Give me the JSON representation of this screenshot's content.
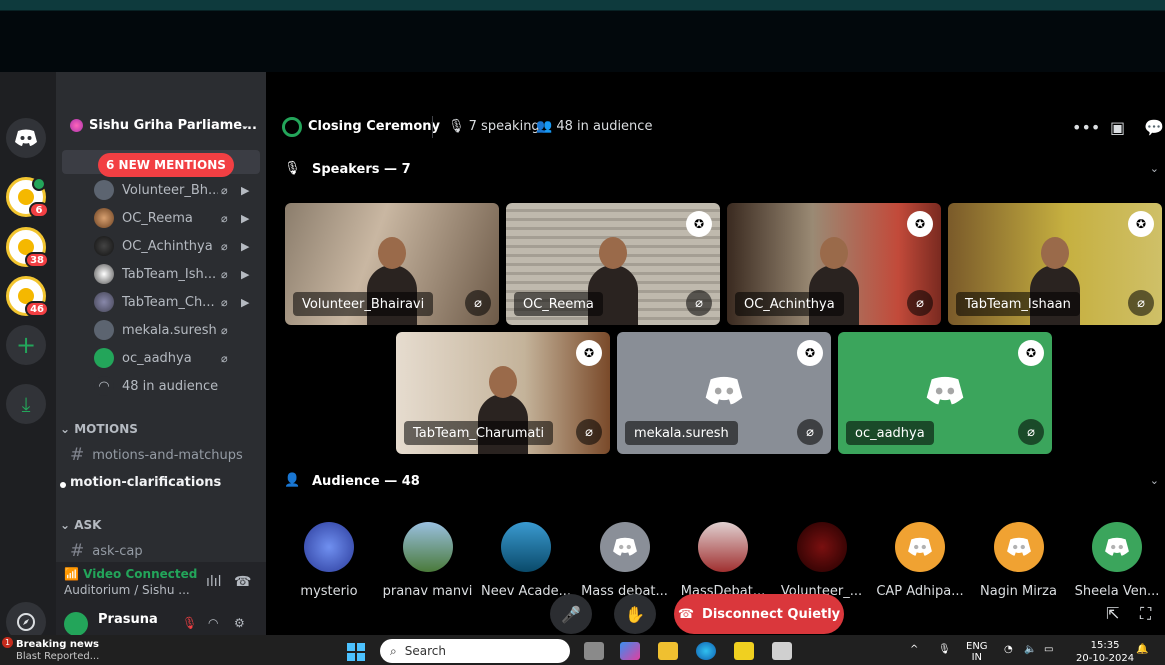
{
  "server": {
    "name": "Sishu Griha Parliame...",
    "mentions": "6 NEW MENTIONS",
    "badges": [
      "6",
      "38",
      "46"
    ]
  },
  "voice_users": [
    {
      "name": "Volunteer_Bh...",
      "avatar": "discord"
    },
    {
      "name": "OC_Reema",
      "avatar": "photo1"
    },
    {
      "name": "OC_Achinthya",
      "avatar": "photo2"
    },
    {
      "name": "TabTeam_Ish...",
      "avatar": "photo3"
    },
    {
      "name": "TabTeam_Ch...",
      "avatar": "photo4"
    },
    {
      "name": "mekala.suresh",
      "avatar": "discord"
    },
    {
      "name": "oc_aadhya",
      "avatar": "green"
    }
  ],
  "audience_row": "48 in audience",
  "categories": {
    "motions": "MOTIONS",
    "ask": "ASK"
  },
  "channels": {
    "motions_and_matchups": "motions-and-matchups",
    "motion_clarifications": "motion-clarifications",
    "ask_cap": "ask-cap"
  },
  "voice_panel": {
    "status": "Video Connected",
    "location": "Auditorium / Sishu ..."
  },
  "user": {
    "name": "Prasuna"
  },
  "stage": {
    "title": "Closing Ceremony",
    "speaking": "7 speaking",
    "audience": "48 in audience",
    "speakers_header": "Speakers — 7",
    "audience_header": "Audience — 48"
  },
  "speakers": [
    {
      "name": "Volunteer_Bhairavi",
      "video": "vid1",
      "moderator": false
    },
    {
      "name": "OC_Reema",
      "video": "vid2",
      "moderator": true
    },
    {
      "name": "OC_Achinthya",
      "video": "vid3",
      "moderator": true
    },
    {
      "name": "TabTeam_Ishaan",
      "video": "vid4",
      "moderator": true
    },
    {
      "name": "TabTeam_Charumati",
      "video": "vid5",
      "moderator": true
    },
    {
      "name": "mekala.suresh",
      "video": "vid-grey",
      "moderator": true
    },
    {
      "name": "oc_aadhya",
      "video": "vid-green",
      "moderator": true
    }
  ],
  "audience": [
    {
      "name": "mysterio",
      "avatar": "c-blue"
    },
    {
      "name": "pranav manvi",
      "avatar": "c-field"
    },
    {
      "name": "Neev Acade...",
      "avatar": "c-sea"
    },
    {
      "name": "Mass debat...",
      "avatar": "c-grey"
    },
    {
      "name": "MassDebat...",
      "avatar": "c-crowd"
    },
    {
      "name": "Volunteer_...",
      "avatar": "c-red"
    },
    {
      "name": "CAP Adhipa...",
      "avatar": "c-orange"
    },
    {
      "name": "Nagin Mirza",
      "avatar": "c-orange"
    },
    {
      "name": "Sheela Ven...",
      "avatar": "c-green"
    }
  ],
  "controls": {
    "disconnect": "Disconnect Quietly"
  },
  "taskbar": {
    "news_badge": "1",
    "news_title": "Breaking news",
    "news_sub": "Blast Reported...",
    "search_placeholder": "Search",
    "lang_line1": "ENG",
    "lang_line2": "IN",
    "time": "15:35",
    "date": "20-10-2024"
  },
  "colors": {
    "accent_green": "#23a55a",
    "danger": "#da373c",
    "mention_red": "#f23f43",
    "background": "#000000",
    "sidebar": "#2b2d31"
  }
}
